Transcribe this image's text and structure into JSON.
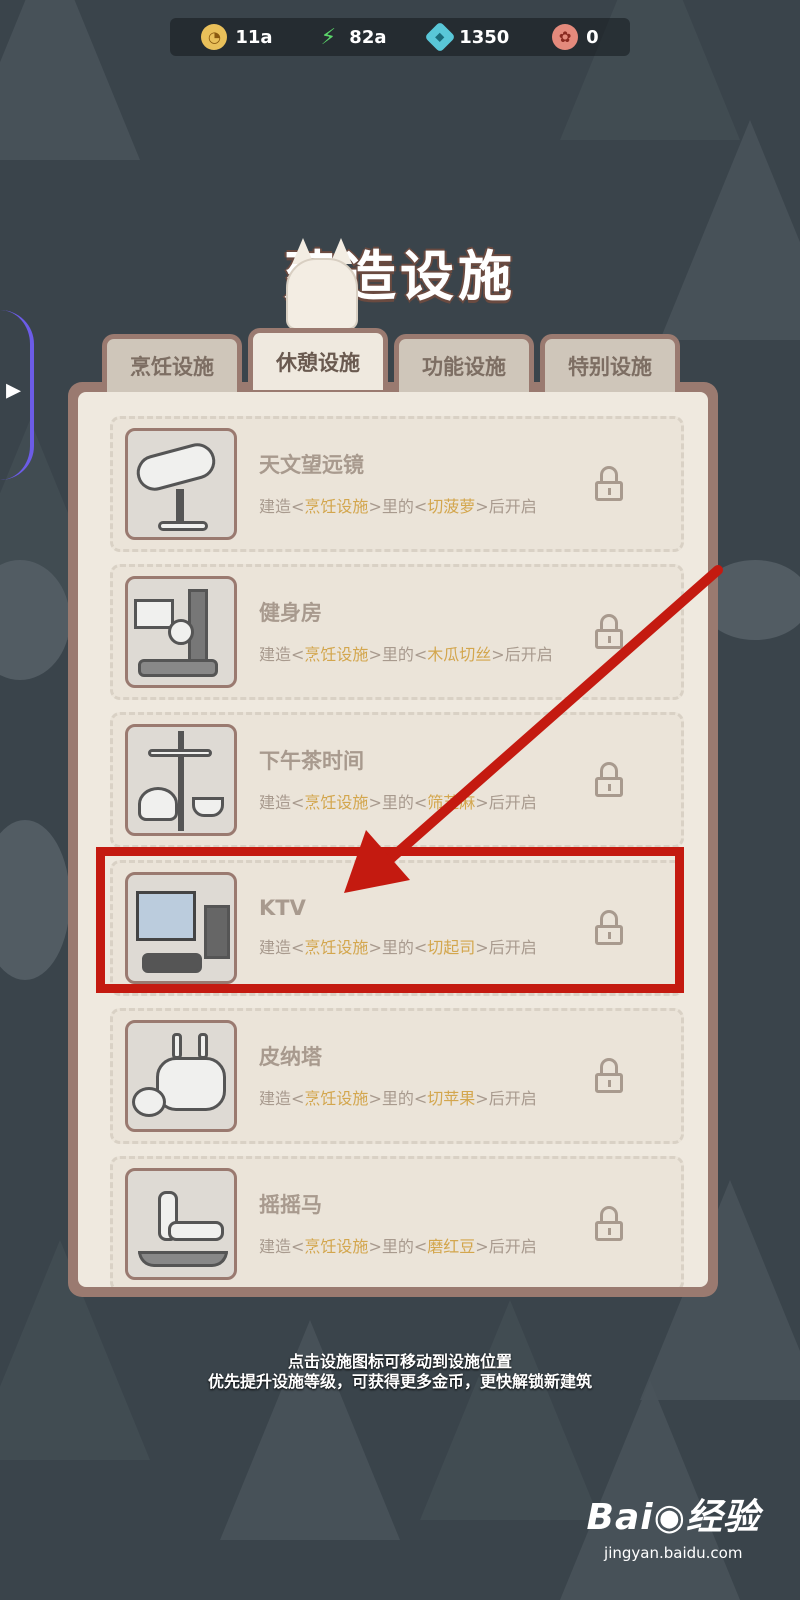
{
  "resources": [
    {
      "icon": "coin-icon",
      "glyph": "◔",
      "value": "11a"
    },
    {
      "icon": "energy-icon",
      "glyph": "⚡",
      "value": "82a"
    },
    {
      "icon": "gem-icon",
      "glyph": "◆",
      "value": "1350"
    },
    {
      "icon": "shell-icon",
      "glyph": "✿",
      "value": "0"
    }
  ],
  "title": "建造设施",
  "tabs": [
    {
      "label": "烹饪设施",
      "active": false
    },
    {
      "label": "休憩设施",
      "active": true
    },
    {
      "label": "功能设施",
      "active": false
    },
    {
      "label": "特别设施",
      "active": false
    }
  ],
  "facilities": [
    {
      "name": "天文望远镜",
      "req_pre": "建造<",
      "req_cat": "烹饪设施",
      "req_mid": ">里的<",
      "req_item": "切菠萝",
      "req_post": ">后开启"
    },
    {
      "name": "健身房",
      "req_pre": "建造<",
      "req_cat": "烹饪设施",
      "req_mid": ">里的<",
      "req_item": "木瓜切丝",
      "req_post": ">后开启"
    },
    {
      "name": "下午茶时间",
      "req_pre": "建造<",
      "req_cat": "烹饪设施",
      "req_mid": ">里的<",
      "req_item": "筛芝麻",
      "req_post": ">后开启"
    },
    {
      "name": "KTV",
      "req_pre": "建造<",
      "req_cat": "烹饪设施",
      "req_mid": ">里的<",
      "req_item": "切起司",
      "req_post": ">后开启"
    },
    {
      "name": "皮纳塔",
      "req_pre": "建造<",
      "req_cat": "烹饪设施",
      "req_mid": ">里的<",
      "req_item": "切苹果",
      "req_post": ">后开启"
    },
    {
      "name": "摇摇马",
      "req_pre": "建造<",
      "req_cat": "烹饪设施",
      "req_mid": ">里的<",
      "req_item": "磨红豆",
      "req_post": ">后开启"
    }
  ],
  "hints": {
    "line1": "点击设施图标可移动到设施位置",
    "line2": "优先提升设施等级，可获得更多金币，更快解锁新建筑"
  },
  "watermark": {
    "logo": "Bai◉经验",
    "url": "jingyan.baidu.com"
  },
  "colors": {
    "highlight_box": "#c41a10",
    "requirement_highlight": "#d3a64d",
    "panel_frame": "#9a7a70",
    "panel_bg": "#efe9df"
  }
}
